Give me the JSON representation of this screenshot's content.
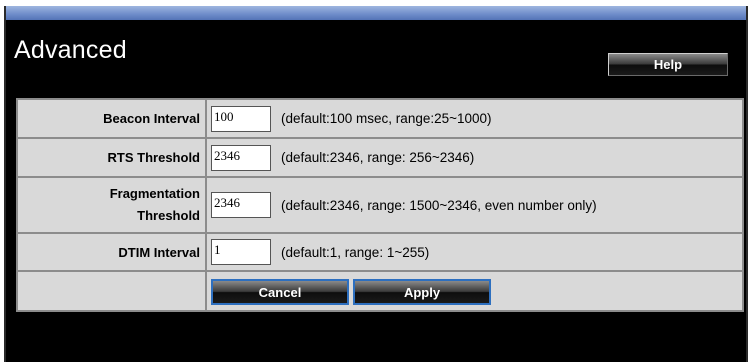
{
  "page": {
    "title": "Advanced",
    "help_label": "Help"
  },
  "settings": [
    {
      "label": "Beacon Interval",
      "value": "100",
      "hint": "(default:100 msec, range:25~1000)"
    },
    {
      "label": "RTS Threshold",
      "value": "2346",
      "hint": "(default:2346, range: 256~2346)"
    },
    {
      "label_line1": "Fragmentation",
      "label_line2": "Threshold",
      "value": "2346",
      "hint": "(default:2346, range: 1500~2346, even number only)"
    },
    {
      "label": "DTIM Interval",
      "value": "1",
      "hint": "(default:1, range: 1~255)"
    }
  ],
  "actions": {
    "cancel_label": "Cancel",
    "apply_label": "Apply"
  },
  "colors": {
    "header_bg": "#000000",
    "table_bg": "#d9d9d9",
    "button_border": "#2d6fbf"
  }
}
